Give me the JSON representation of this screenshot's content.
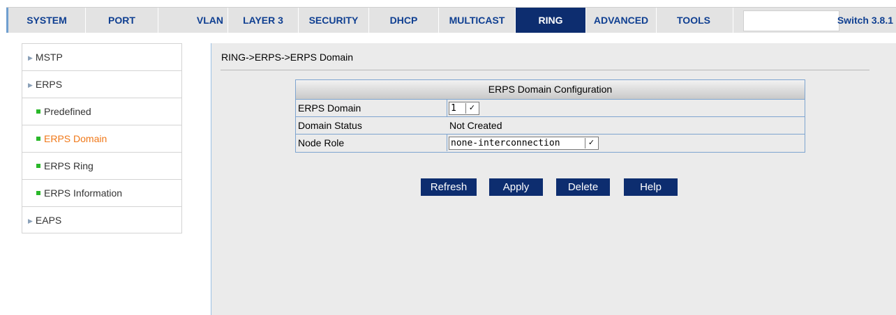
{
  "nav": {
    "tabs": [
      {
        "label": "SYSTEM"
      },
      {
        "label": "PORT"
      },
      {
        "label": "VLAN"
      },
      {
        "label": "LAYER 3"
      },
      {
        "label": "SECURITY"
      },
      {
        "label": "DHCP"
      },
      {
        "label": "MULTICAST"
      },
      {
        "label": "RING"
      },
      {
        "label": "ADVANCED"
      },
      {
        "label": "TOOLS"
      }
    ],
    "active_tab": "RING",
    "version": "Switch 3.8.1"
  },
  "sidebar": {
    "items": [
      {
        "label": "MSTP"
      },
      {
        "label": "ERPS"
      },
      {
        "label": "Predefined"
      },
      {
        "label": "ERPS Domain"
      },
      {
        "label": "ERPS Ring"
      },
      {
        "label": "ERPS Information"
      },
      {
        "label": "EAPS"
      }
    ]
  },
  "main": {
    "breadcrumb": "RING->ERPS->ERPS Domain",
    "table": {
      "title": "ERPS Domain Configuration",
      "rows": [
        {
          "label": "ERPS Domain",
          "value": "1"
        },
        {
          "label": "Domain Status",
          "value": "Not Created"
        },
        {
          "label": "Node Role",
          "value": "none-interconnection"
        }
      ]
    },
    "buttons": {
      "refresh": "Refresh",
      "apply": "Apply",
      "delete": "Delete",
      "help": "Help"
    }
  },
  "colors": {
    "nav_active_bg": "#0d2d6f",
    "nav_text": "#0f3f91",
    "current_item": "#f07818",
    "bullet": "#2ab82a"
  }
}
